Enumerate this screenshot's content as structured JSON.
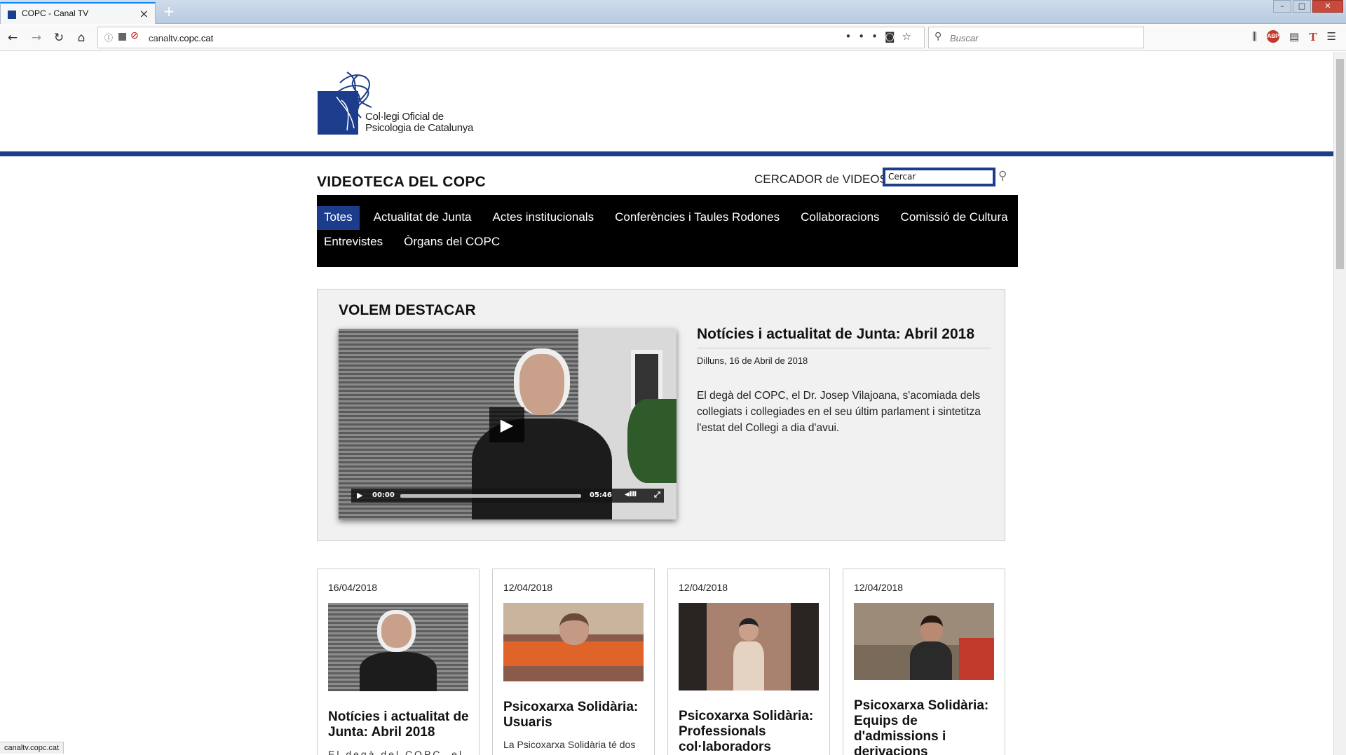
{
  "browser": {
    "tab_title": "COPC - Canal TV",
    "url_prefix": "canaltv.",
    "url_domain": "copc.cat",
    "search_placeholder": "Buscar",
    "status_url": "canaltv.copc.cat"
  },
  "site": {
    "logo_line1": "Col·legi Oficial de",
    "logo_line2": "Psicologia de Catalunya",
    "brand_color": "#1c3d8c",
    "page_title": "VIDEOTECA DEL COPC",
    "search_label": "CERCADOR de VIDEOS",
    "search_value": "Cercar"
  },
  "categories": [
    {
      "label": "Totes",
      "active": true
    },
    {
      "label": "Actualitat de Junta",
      "active": false
    },
    {
      "label": "Actes institucionals",
      "active": false
    },
    {
      "label": "Conferències i Taules Rodones",
      "active": false
    },
    {
      "label": "Collaboracions",
      "active": false
    },
    {
      "label": "Comissió de Cultura",
      "active": false
    },
    {
      "label": "Entrevistes",
      "active": false
    },
    {
      "label": "Òrgans del COPC",
      "active": false
    }
  ],
  "featured": {
    "heading": "VOLEM DESTACAR",
    "title": "Notícies i actualitat de Junta: Abril 2018",
    "date": "Dilluns, 16 de Abril de 2018",
    "description": "El degà del COPC, el Dr. Josep Vilajoana, s'acomiada dels collegiats i collegiades en el seu últim parlament i sintetitza l'estat del Collegi a dia d'avui.",
    "time_current": "00:00",
    "time_total": "05:46"
  },
  "videos": [
    {
      "date": "16/04/2018",
      "title": "Notícies i actualitat de Junta: Abril 2018",
      "excerpt": "El degà del COPC, el Dr"
    },
    {
      "date": "12/04/2018",
      "title": "Psicoxarxa Solidària: Usuaris",
      "excerpt": "La Psicoxarxa Solidària té dos"
    },
    {
      "date": "12/04/2018",
      "title": "Psicoxarxa Solidària: Professionals col·laboradors",
      "excerpt": ""
    },
    {
      "date": "12/04/2018",
      "title": "Psicoxarxa Solidària: Equips de d'admissions i derivacions",
      "excerpt": ""
    }
  ]
}
